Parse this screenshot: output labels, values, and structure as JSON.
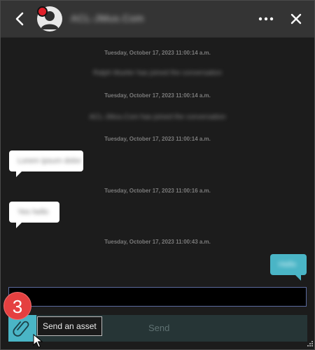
{
  "header": {
    "contact_name": "ACL-JMus.Com",
    "back_icon": "chevron-left-icon",
    "more_icon": "ellipsis-icon",
    "close_icon": "close-icon"
  },
  "messages": [
    {
      "kind": "timestamp",
      "text": "Tuesday, October 17, 2023 11:00:14 a.m."
    },
    {
      "kind": "system",
      "text": "Ralph Mueler has joined the conversation"
    },
    {
      "kind": "timestamp",
      "text": "Tuesday, October 17, 2023 11:00:14 a.m."
    },
    {
      "kind": "system",
      "text": "ACL-JMus.Com has joined the conversation"
    },
    {
      "kind": "timestamp",
      "text": "Tuesday, October 17, 2023 11:00:14 a.m."
    },
    {
      "kind": "incoming",
      "text": "Lorem ipsum dolor"
    },
    {
      "kind": "timestamp",
      "text": "Tuesday, October 17, 2023 11:00:16 a.m."
    },
    {
      "kind": "incoming",
      "text": "Yes hello"
    },
    {
      "kind": "timestamp",
      "text": "Tuesday, October 17, 2023 11:00:43 a.m."
    },
    {
      "kind": "outgoing",
      "text": "Hello"
    }
  ],
  "composer": {
    "input_value": "",
    "send_label": "Send",
    "attach_icon": "paperclip-icon"
  },
  "callout": {
    "step_number": "3",
    "tooltip": "Send an asset"
  },
  "colors": {
    "accent": "#4ab5c6",
    "badge": "#e54040",
    "header_bg": "#343434",
    "chat_bg": "#1c1c1c"
  }
}
